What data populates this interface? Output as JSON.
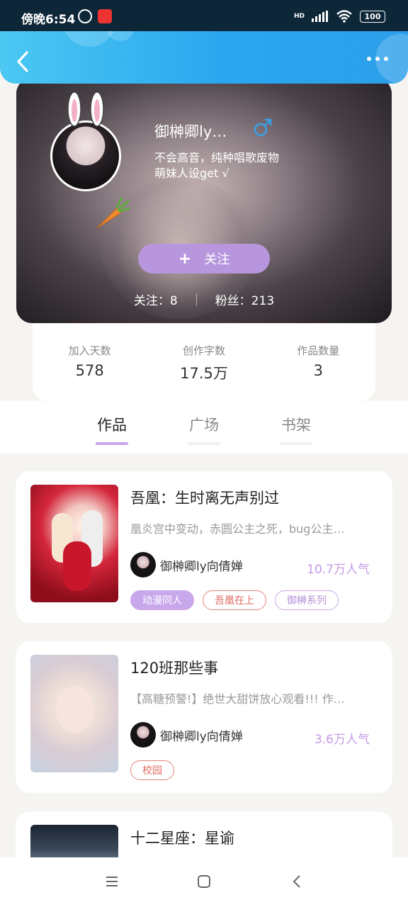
{
  "status_bar": {
    "time": "傍晚6:54",
    "network": "HD",
    "battery": "100"
  },
  "profile": {
    "username": "御榊卿ly…",
    "gender_symbol": "♂",
    "bio_line1": "不会高音，纯种唱歌废物",
    "bio_line2": "萌妹人设get √",
    "follow_plus": "+",
    "follow_label": "关注",
    "following": "关注：8",
    "fans": "粉丝：213"
  },
  "stats": [
    {
      "label": "加入天数",
      "value": "578"
    },
    {
      "label": "创作字数",
      "value": "17.5万"
    },
    {
      "label": "作品数量",
      "value": "3"
    }
  ],
  "tabs": [
    {
      "label": "作品",
      "active": true
    },
    {
      "label": "广场",
      "active": false
    },
    {
      "label": "书架",
      "active": false
    }
  ],
  "works": [
    {
      "title": "吾凰：生时离无声别过",
      "desc": "凰炎宫中变动，赤圆公主之死，bug公主…",
      "author": "御榊卿ly向倩婵",
      "popularity": "10.7万人气",
      "tags": [
        "动漫同人",
        "吾凰在上",
        "御榊系列"
      ]
    },
    {
      "title": "120班那些事",
      "desc": "【高糖预警!】绝世大甜饼放心观看!!! 作…",
      "author": "御榊卿ly向倩婵",
      "popularity": "3.6万人气",
      "tags": [
        "校园"
      ]
    },
    {
      "title": "十二星座：星谕"
    }
  ],
  "colors": {
    "accent": "#b896de",
    "header": "#2aa6ef",
    "tag_red": "#e06a60"
  }
}
